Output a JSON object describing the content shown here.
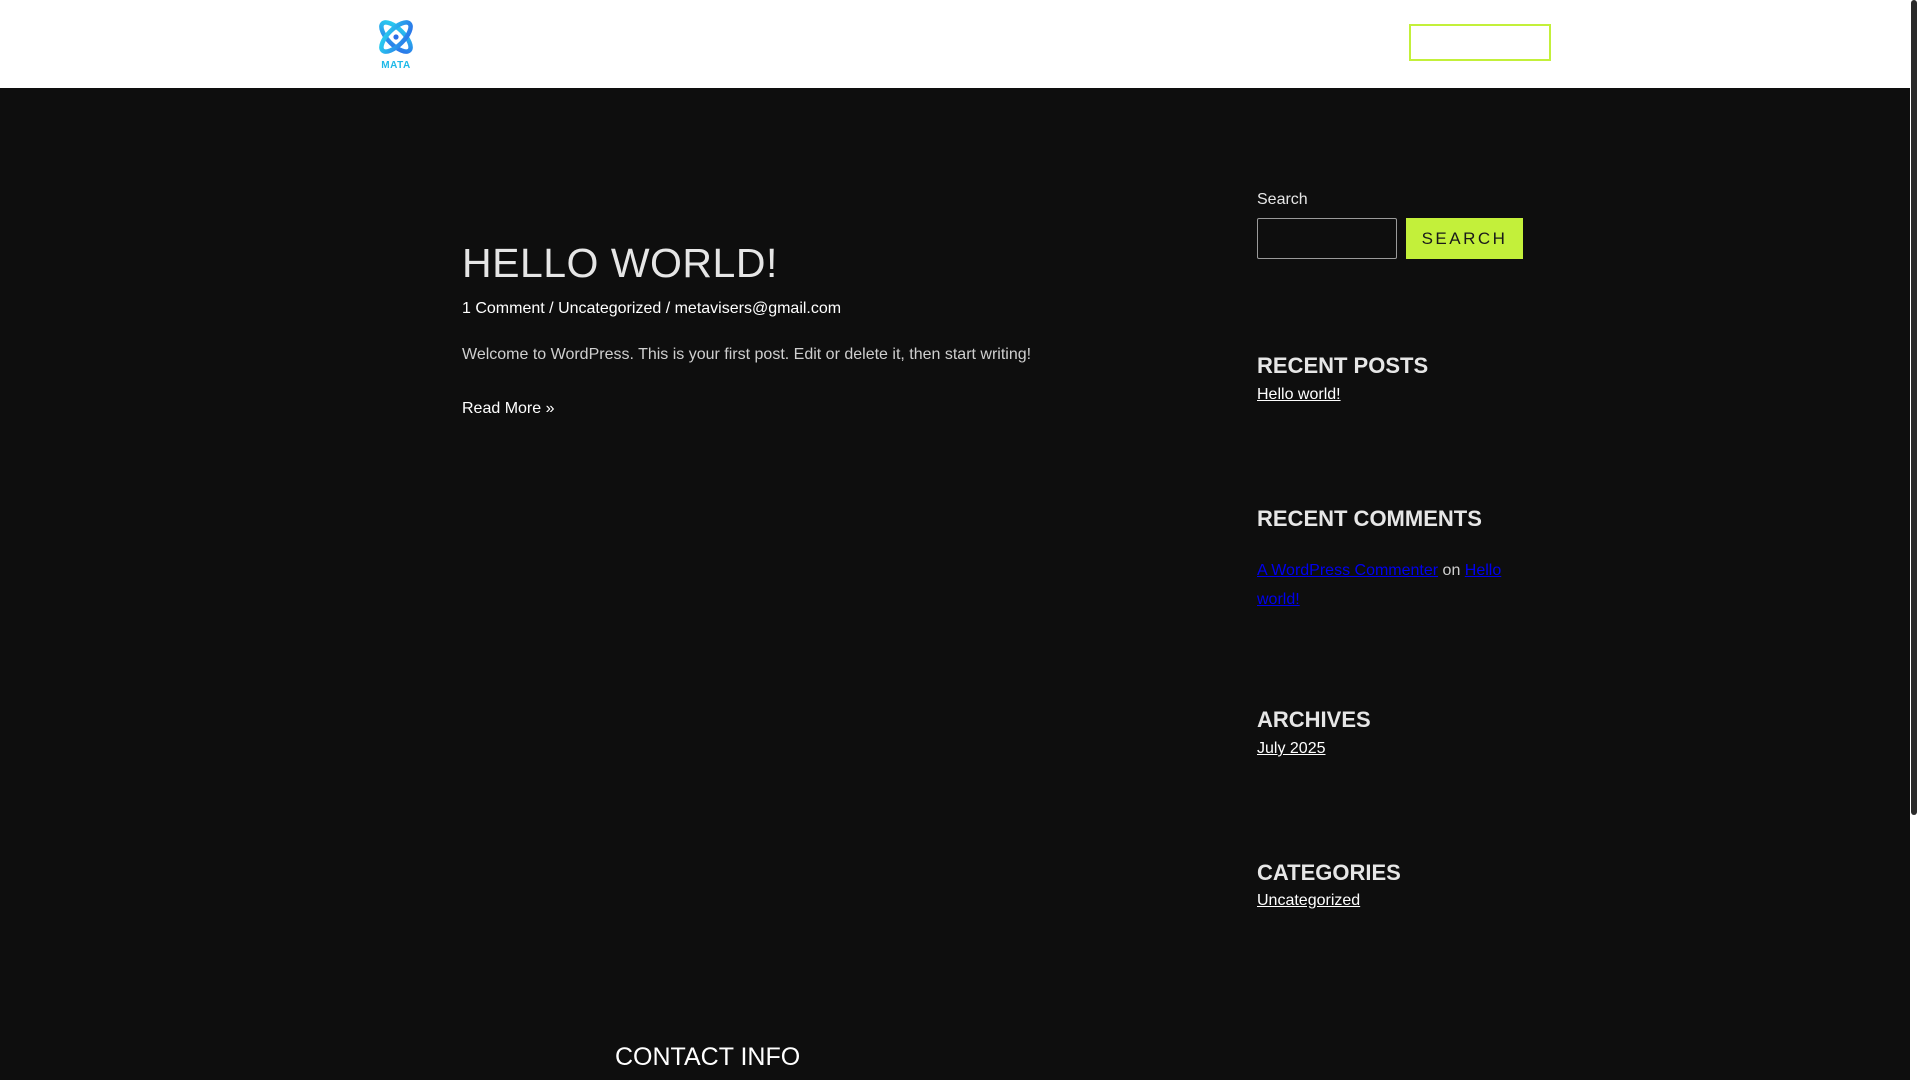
{
  "brand": {
    "logo_text": "MATA",
    "accent_color": "#c3f03a",
    "logo_color": "#1fb9e8"
  },
  "post": {
    "title": "HELLO WORLD!",
    "meta": {
      "comments": "1 Comment",
      "separator": "/",
      "category": "Uncategorized",
      "author": "metavisers@gmail.com"
    },
    "excerpt": "Welcome to WordPress. This is your first post. Edit or delete it, then start writing!",
    "read_more": "Read More »"
  },
  "sidebar": {
    "search": {
      "label": "Search",
      "button": "SEARCH",
      "value": ""
    },
    "recent_posts": {
      "title": "RECENT POSTS",
      "items": [
        "Hello world!"
      ]
    },
    "recent_comments": {
      "title": "RECENT COMMENTS",
      "commenter": "A WordPress Commenter",
      "on": "on",
      "post_line1": "Hello",
      "post_line2": "world!"
    },
    "archives": {
      "title": "ARCHIVES",
      "items": [
        "July 2025"
      ]
    },
    "categories": {
      "title": "CATEGORIES",
      "items": [
        "Uncategorized"
      ]
    }
  },
  "footer": {
    "contact_title": "CONTACT INFO"
  }
}
